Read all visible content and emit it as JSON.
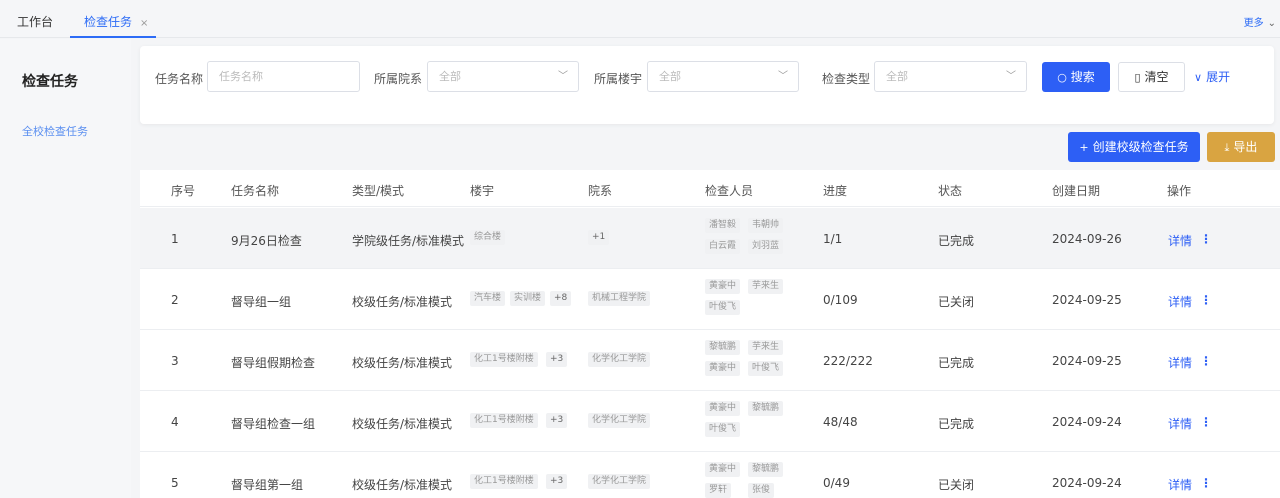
{
  "tabs": {
    "home": "工作台",
    "active": "检查任务",
    "close": "×",
    "more": "更多"
  },
  "sidebar": {
    "title": "检查任务",
    "items": [
      {
        "label": "全校检查任务"
      }
    ]
  },
  "filter": {
    "task_name_label": "任务名称",
    "task_name_placeholder": "任务名称",
    "college_label": "所属院系",
    "college_value": "全部",
    "building_label": "所属楼宇",
    "building_value": "全部",
    "type_label": "检查类型",
    "type_value": "全部",
    "search": "搜索",
    "clear": "清空",
    "expand": "展开"
  },
  "actions": {
    "create": "创建校级检查任务",
    "export": "导出"
  },
  "table": {
    "columns": [
      "序号",
      "任务名称",
      "类型/模式",
      "楼宇",
      "院系",
      "检查人员",
      "进度",
      "状态",
      "创建日期",
      "操作"
    ],
    "detail_label": "详情",
    "rows": [
      {
        "no": "1",
        "name": "9月26日检查",
        "type": "学院级任务/标准模式",
        "buildings": [
          "综合楼"
        ],
        "buildings_more": "",
        "colleges": [],
        "colleges_more": "+1",
        "inspectors": [
          "潘智毅",
          "韦朝帅",
          "白云霞",
          "刘羽蓝"
        ],
        "progress": "1/1",
        "status": "已完成",
        "date": "2024-09-26"
      },
      {
        "no": "2",
        "name": "督导组一组",
        "type": "校级任务/标准模式",
        "buildings": [
          "汽车楼",
          "实训楼"
        ],
        "buildings_more": "+8",
        "colleges": [
          "机械工程学院"
        ],
        "colleges_more": "",
        "inspectors": [
          "黄豪中",
          "芋来生",
          "叶俊飞"
        ],
        "progress": "0/109",
        "status": "已关闭",
        "date": "2024-09-25"
      },
      {
        "no": "3",
        "name": "督导组假期检查",
        "type": "校级任务/标准模式",
        "buildings": [
          "化工1号楼附楼"
        ],
        "buildings_more": "+3",
        "colleges": [
          "化学化工学院"
        ],
        "colleges_more": "",
        "inspectors": [
          "黎毓鹏",
          "芋来生",
          "黄豪中",
          "叶俊飞"
        ],
        "progress": "222/222",
        "status": "已完成",
        "date": "2024-09-25"
      },
      {
        "no": "4",
        "name": "督导组检查一组",
        "type": "校级任务/标准模式",
        "buildings": [
          "化工1号楼附楼"
        ],
        "buildings_more": "+3",
        "colleges": [
          "化学化工学院"
        ],
        "colleges_more": "",
        "inspectors": [
          "黄豪中",
          "黎毓鹏",
          "叶俊飞"
        ],
        "progress": "48/48",
        "status": "已完成",
        "date": "2024-09-24"
      },
      {
        "no": "5",
        "name": "督导组第一组",
        "type": "校级任务/标准模式",
        "buildings": [
          "化工1号楼附楼"
        ],
        "buildings_more": "+3",
        "colleges": [
          "化学化工学院"
        ],
        "colleges_more": "",
        "inspectors": [
          "黄豪中",
          "黎毓鹏",
          "罗轩",
          "张俊"
        ],
        "progress": "0/49",
        "status": "已关闭",
        "date": "2024-09-24"
      }
    ]
  }
}
